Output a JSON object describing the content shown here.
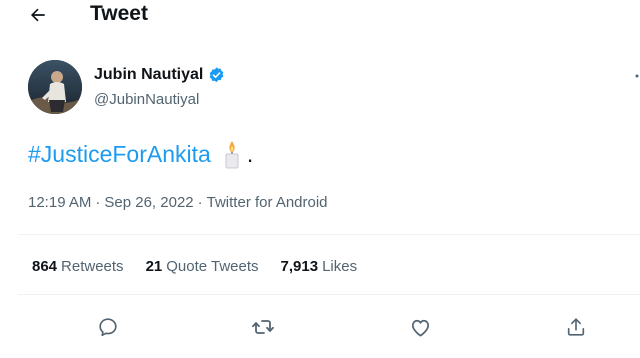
{
  "header": {
    "title": "Tweet",
    "back_icon": "arrow-left-icon"
  },
  "author": {
    "display_name": "Jubin Nautiyal",
    "handle": "@JubinNautiyal",
    "verified_icon": "verified-badge-icon",
    "verified_color": "#1d9bf0"
  },
  "tweet": {
    "hashtag": "#JusticeForAnkita",
    "emoji_icon": "candle-icon",
    "trailing_text": ".",
    "hashtag_color": "#1d9bf0"
  },
  "meta": {
    "time": "12:19 AM",
    "separator": "·",
    "date": "Sep 26, 2022",
    "source": "Twitter for Android"
  },
  "stats": {
    "retweets_count": "864",
    "retweets_label": "Retweets",
    "quote_count": "21",
    "quote_label": "Quote Tweets",
    "likes_count": "7,913",
    "likes_label": "Likes"
  },
  "actions": [
    "reply-icon",
    "retweet-icon",
    "like-icon",
    "share-icon"
  ],
  "colors": {
    "text_primary": "#0f1419",
    "text_secondary": "#536471",
    "accent": "#1d9bf0",
    "divider": "#eff3f4"
  }
}
